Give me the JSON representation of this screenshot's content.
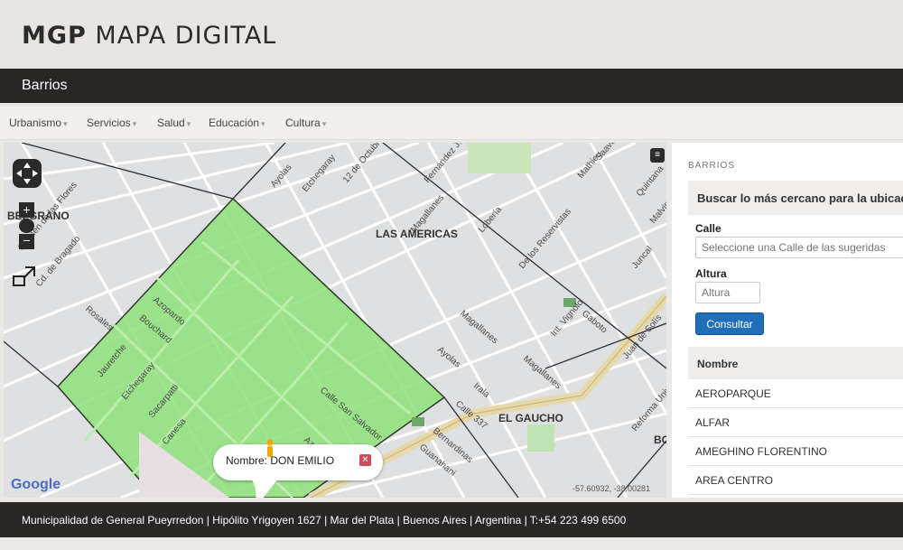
{
  "header": {
    "brand_bold": "MGP",
    "brand_light": "MAPA DIGITAL"
  },
  "titlebar": {
    "title": "Barrios"
  },
  "menu": [
    {
      "label": "Urbanismo"
    },
    {
      "label": "Servicios"
    },
    {
      "label": "Salud"
    },
    {
      "label": "Educación"
    },
    {
      "label": "Cultura"
    }
  ],
  "map": {
    "labels": {
      "las_americas": "LAS AMERICAS",
      "el_gaucho": "EL GAUCHO",
      "belgrano": "BELGRANO",
      "bo": "BO"
    },
    "popup_text": "Nombre: DON EMILIO",
    "coords": "-57.60932, -38.00281",
    "google": "Google",
    "icons": [
      "pan-control-icon",
      "zoom-in-icon",
      "zoom-out-icon",
      "fullscreen-icon",
      "layers-icon",
      "pegman-icon",
      "close-icon"
    ]
  },
  "panel": {
    "heading": "BARRIOS",
    "search_title": "Buscar lo más cercano para la ubicación",
    "calle_label": "Calle",
    "calle_placeholder": "Seleccione una Calle de las sugeridas",
    "altura_label": "Altura",
    "altura_placeholder": "Altura",
    "consultar": "Consultar",
    "table_header": "Nombre",
    "rows": [
      "AEROPARQUE",
      "ALFAR",
      "AMEGHINO FLORENTINO",
      "AREA CENTRO"
    ]
  },
  "footer": {
    "text": "Municipalidad de General Pueyrredon | Hipólito Yrigoyen 1627 | Mar del Plata | Buenos Aires | Argentina | T:+54 223 499 6500"
  },
  "colors": {
    "header_dark": "#2a2626",
    "polygon_green": "#8fe07a",
    "button_blue": "#1f6fb8",
    "road_beige": "#e6d8a8"
  }
}
